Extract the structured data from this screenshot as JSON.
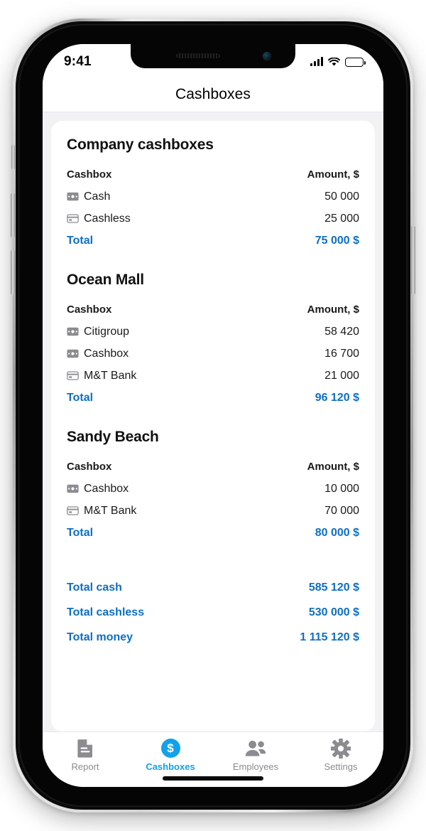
{
  "status_bar": {
    "time": "9:41",
    "signal_icon": "cellular-signal-icon",
    "wifi_icon": "wifi-icon",
    "battery_icon": "battery-icon"
  },
  "header": {
    "title": "Cashboxes"
  },
  "colors": {
    "accent_blue": "#12a2ea",
    "total_blue": "#0e6fc4",
    "page_background": "#f2f2f5",
    "card_background": "#ffffff",
    "icon_gray": "#8b8b90"
  },
  "sections": [
    {
      "title": "Company cashboxes",
      "col_name": "Cashbox",
      "col_amount": "Amount, $",
      "rows": [
        {
          "icon": "cash-banknote-icon",
          "label": "Cash",
          "amount": "50 000"
        },
        {
          "icon": "credit-card-icon",
          "label": "Cashless",
          "amount": "25 000"
        }
      ],
      "total_label": "Total",
      "total_amount": "75 000 $"
    },
    {
      "title": "Ocean Mall",
      "col_name": "Cashbox",
      "col_amount": "Amount, $",
      "rows": [
        {
          "icon": "cash-banknote-icon",
          "label": "Citigroup",
          "amount": "58 420"
        },
        {
          "icon": "cash-banknote-icon",
          "label": "Cashbox",
          "amount": "16 700"
        },
        {
          "icon": "credit-card-icon",
          "label": "M&T Bank",
          "amount": "21 000"
        }
      ],
      "total_label": "Total",
      "total_amount": "96 120 $"
    },
    {
      "title": "Sandy Beach",
      "col_name": "Cashbox",
      "col_amount": "Amount, $",
      "rows": [
        {
          "icon": "cash-banknote-icon",
          "label": "Cashbox",
          "amount": "10 000"
        },
        {
          "icon": "credit-card-icon",
          "label": "M&T Bank",
          "amount": "70 000"
        }
      ],
      "total_label": "Total",
      "total_amount": "80 000 $"
    }
  ],
  "grand_totals": [
    {
      "label": "Total cash",
      "amount": "585 120 $"
    },
    {
      "label": "Total cashless",
      "amount": "530 000 $"
    },
    {
      "label": "Total money",
      "amount": "1 115 120 $"
    }
  ],
  "tabbar": {
    "items": [
      {
        "label": "Report",
        "icon": "document-report-icon",
        "active": false
      },
      {
        "label": "Cashboxes",
        "icon": "dollar-circle-icon",
        "active": true
      },
      {
        "label": "Employees",
        "icon": "people-group-icon",
        "active": false
      },
      {
        "label": "Settings",
        "icon": "gear-icon",
        "active": false
      }
    ]
  }
}
